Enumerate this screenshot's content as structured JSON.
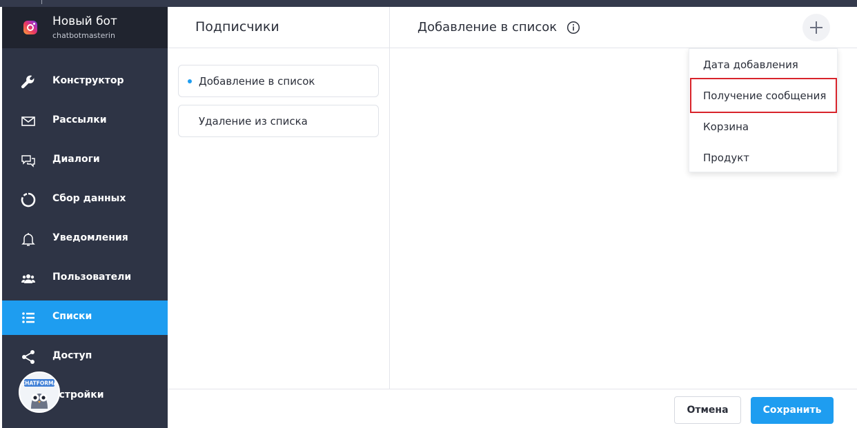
{
  "bot": {
    "name": "Новый бот",
    "handle": "chatbotmasterin"
  },
  "nav": [
    {
      "label": "Конструктор",
      "icon": "wrench-icon"
    },
    {
      "label": "Рассылки",
      "icon": "envelope-icon"
    },
    {
      "label": "Диалоги",
      "icon": "chat-bubbles-icon"
    },
    {
      "label": "Сбор данных",
      "icon": "circle-progress-icon"
    },
    {
      "label": "Уведомления",
      "icon": "bell-icon"
    },
    {
      "label": "Пользователи",
      "icon": "users-icon"
    },
    {
      "label": "Списки",
      "icon": "list-icon",
      "active": true
    },
    {
      "label": "Доступ",
      "icon": "share-icon"
    },
    {
      "label": "астройки",
      "icon": "settings-icon"
    }
  ],
  "owl_badge": "CHATFORMA",
  "subscribers": {
    "title": "Подписчики",
    "events": [
      {
        "label": "Добавление в список",
        "selected": true
      },
      {
        "label": "Удаление из списка",
        "selected": false
      }
    ]
  },
  "editor": {
    "title": "Добавление в список",
    "info_icon": "info-icon",
    "add_icon": "plus-icon"
  },
  "dropdown": {
    "items": [
      "Дата добавления",
      "Получение сообщения",
      "Корзина",
      "Продукт"
    ],
    "highlighted_index": 1,
    "highlight_color": "#d8232a"
  },
  "footer": {
    "cancel_label": "Отмена",
    "save_label": "Сохранить"
  },
  "colors": {
    "accent": "#1e9df0",
    "sidebar": "#2e3445",
    "sidebar_header": "#20242f"
  }
}
